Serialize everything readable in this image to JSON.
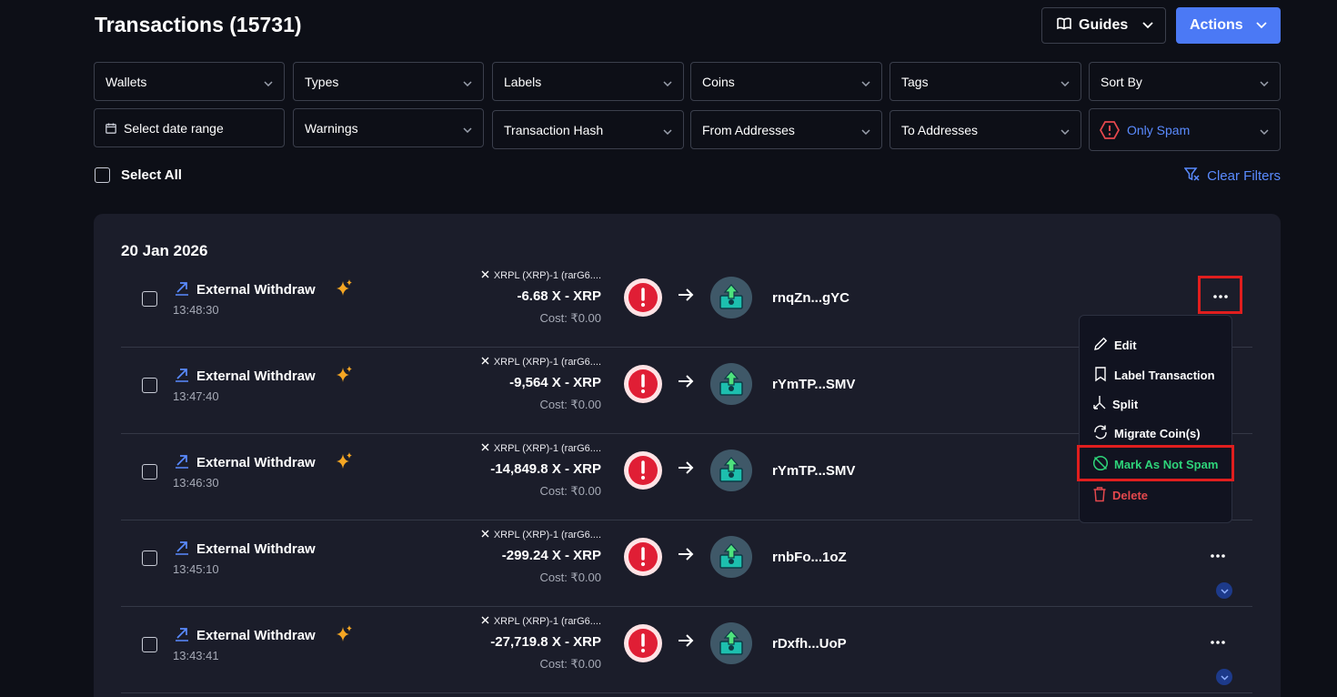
{
  "header": {
    "title": "Transactions (15731)",
    "guides_label": "Guides",
    "actions_label": "Actions"
  },
  "filters": {
    "wallets": "Wallets",
    "types": "Types",
    "labels": "Labels",
    "coins": "Coins",
    "tags": "Tags",
    "sort_by": "Sort By",
    "date_range": "Select date range",
    "warnings": "Warnings",
    "tx_hash": "Transaction Hash",
    "from_addresses": "From Addresses",
    "to_addresses": "To Addresses",
    "only_spam": "Only Spam"
  },
  "select_all": "Select All",
  "clear_filters": "Clear Filters",
  "date_group": "20 Jan 2026",
  "colors": {
    "accent": "#4b79f5",
    "warning": "#e01e1e",
    "success": "#2ed47a",
    "danger": "#e5484d",
    "spark": "#f5a623"
  },
  "transactions": [
    {
      "type": "External Withdraw",
      "time": "13:48:30",
      "coin": "XRPL (XRP)-1 (rarG6....",
      "amount": "-6.68 X - XRP",
      "cost": "Cost: ₹0.00",
      "address": "rnqZn...gYC",
      "sparkle": true
    },
    {
      "type": "External Withdraw",
      "time": "13:47:40",
      "coin": "XRPL (XRP)-1 (rarG6....",
      "amount": "-9,564 X - XRP",
      "cost": "Cost: ₹0.00",
      "address": "rYmTP...SMV",
      "sparkle": true
    },
    {
      "type": "External Withdraw",
      "time": "13:46:30",
      "coin": "XRPL (XRP)-1 (rarG6....",
      "amount": "-14,849.8 X - XRP",
      "cost": "Cost: ₹0.00",
      "address": "rYmTP...SMV",
      "sparkle": true
    },
    {
      "type": "External Withdraw",
      "time": "13:45:10",
      "coin": "XRPL (XRP)-1 (rarG6....",
      "amount": "-299.24 X - XRP",
      "cost": "Cost: ₹0.00",
      "address": "rnbFo...1oZ",
      "sparkle": false
    },
    {
      "type": "External Withdraw",
      "time": "13:43:41",
      "coin": "XRPL (XRP)-1 (rarG6....",
      "amount": "-27,719.8 X - XRP",
      "cost": "Cost: ₹0.00",
      "address": "rDxfh...UoP",
      "sparkle": true
    }
  ],
  "menu": {
    "edit": "Edit",
    "label_transaction": "Label Transaction",
    "split": "Split",
    "migrate": "Migrate Coin(s)",
    "mark_not_spam": "Mark As Not Spam",
    "delete": "Delete"
  }
}
